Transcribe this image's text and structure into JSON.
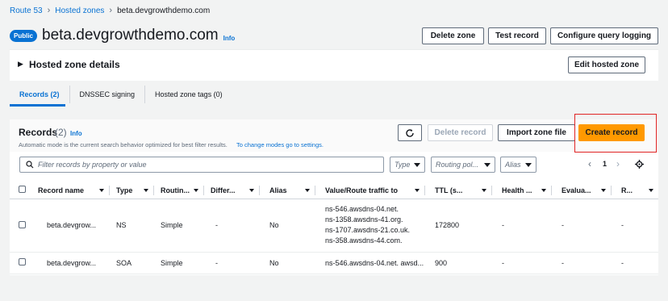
{
  "breadcrumb": {
    "root": "Route 53",
    "zones": "Hosted zones",
    "current": "beta.devgrowthdemo.com"
  },
  "header": {
    "badge": "Public",
    "title": "beta.devgrowthdemo.com",
    "info": "Info"
  },
  "actions": {
    "delete_zone": "Delete zone",
    "test_record": "Test record",
    "configure_logging": "Configure query logging"
  },
  "details": {
    "title": "Hosted zone details",
    "edit_button": "Edit hosted zone"
  },
  "tabs": [
    {
      "label": "Records (2)"
    },
    {
      "label": "DNSSEC signing"
    },
    {
      "label": "Hosted zone tags (0)"
    }
  ],
  "records": {
    "title": "Records",
    "count": "(2)",
    "info": "Info",
    "description": "Automatic mode is the current search behavior optimized for best filter results.",
    "description_link": "To change modes go to settings.",
    "refresh_icon": "refresh-icon",
    "delete_record": "Delete record",
    "import_zone_file": "Import zone file",
    "create_record": "Create record",
    "search_placeholder": "Filter records by property or value",
    "filter_type": "Type",
    "filter_routing": "Routing pol...",
    "filter_alias": "Alias",
    "page_number": "1"
  },
  "table": {
    "headers": [
      "Record name",
      "Type",
      "Routin...",
      "Differ...",
      "Alias",
      "Value/Route traffic to",
      "TTL (s...",
      "Health ...",
      "Evalua...",
      "R..."
    ],
    "rows": [
      {
        "name": "beta.devgrow...",
        "type": "NS",
        "routing": "Simple",
        "differ": "-",
        "alias": "No",
        "value": [
          "ns-546.awsdns-04.net.",
          "ns-1358.awsdns-41.org.",
          "ns-1707.awsdns-21.co.uk.",
          "ns-358.awsdns-44.com."
        ],
        "ttl": "172800",
        "health": "-",
        "evaluate": "-",
        "r": "-"
      },
      {
        "name": "beta.devgrow...",
        "type": "SOA",
        "routing": "Simple",
        "differ": "-",
        "alias": "No",
        "value": [
          "ns-546.awsdns-04.net. awsd..."
        ],
        "ttl": "900",
        "health": "-",
        "evaluate": "-",
        "r": "-"
      }
    ]
  },
  "colors": {
    "accent": "#0972d3",
    "primary": "#ff9900",
    "highlight": "#e02424"
  }
}
